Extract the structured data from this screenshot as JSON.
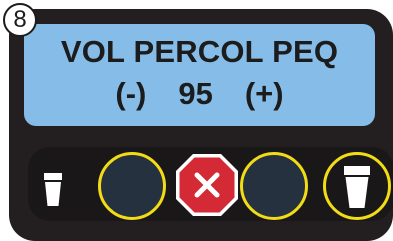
{
  "step_number": "8",
  "display": {
    "line1": "VOL PERCOL PEQ",
    "decrease_label": "(-)",
    "value": "95",
    "increase_label": "(+)"
  },
  "buttons": {
    "small_cup_icon": "small-cup-icon",
    "left_round": "round-button",
    "stop": "stop-x-icon",
    "right_round": "round-button",
    "large_cup": "large-cup-icon"
  },
  "colors": {
    "panel": "#231f20",
    "display": "#86bde8",
    "button_ring": "#f2dc16",
    "button_fill": "#263140",
    "stop": "#d42a36"
  }
}
